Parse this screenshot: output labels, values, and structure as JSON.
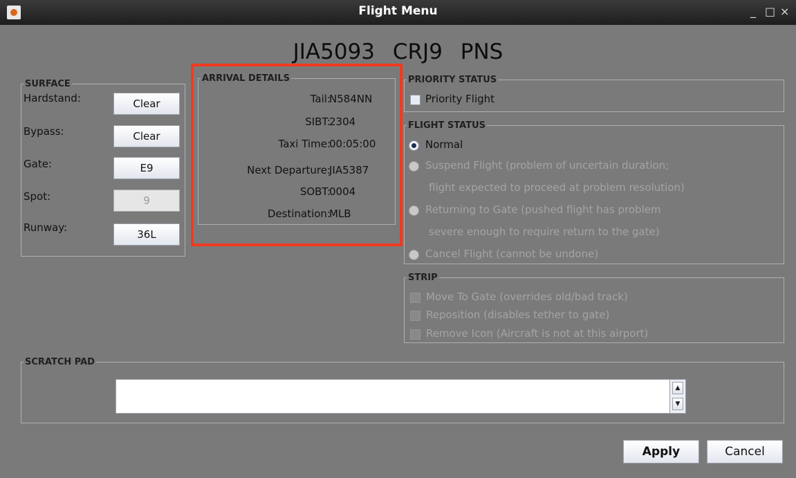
{
  "window": {
    "title": "Flight Menu",
    "minimize": "_",
    "maximize": "□",
    "close": "×",
    "app_icon": "java-cup-icon"
  },
  "header": {
    "callsign": "JIA5093",
    "aircraft_type": "CRJ9",
    "origin": "PNS"
  },
  "surface": {
    "legend": "SURFACE",
    "rows": [
      {
        "label": "Hardstand:",
        "button": "Clear"
      },
      {
        "label": "Bypass:",
        "button": "Clear"
      },
      {
        "label": "Gate:",
        "button": "E9"
      },
      {
        "label": "Spot:",
        "button": "9"
      },
      {
        "label": "Runway:",
        "button": "36L"
      }
    ]
  },
  "arrival": {
    "legend": "ARRIVAL DETAILS",
    "rows": [
      {
        "key": "Tail:",
        "value": "N584NN"
      },
      {
        "key": "SIBT:",
        "value": "2304"
      },
      {
        "key": "Taxi Time:",
        "value": "00:05:00"
      },
      {
        "key": "Next Departure:",
        "value": "JIA5387"
      },
      {
        "key": "SOBT:",
        "value": "0004"
      },
      {
        "key": "Destination:",
        "value": "MLB"
      }
    ]
  },
  "priority": {
    "legend": "PRIORITY STATUS",
    "checkbox_label": "Priority Flight",
    "checked": false
  },
  "flight_status": {
    "legend": "FLIGHT STATUS",
    "options": [
      {
        "line1": "Normal",
        "line2": "",
        "selected": true,
        "enabled": true
      },
      {
        "line1": "Suspend Flight (problem of uncertain duration;",
        "line2": "flight expected to proceed at problem resolution)",
        "selected": false,
        "enabled": false
      },
      {
        "line1": "Returning to Gate (pushed flight has problem",
        "line2": "severe enough to require return to the gate)",
        "selected": false,
        "enabled": false
      },
      {
        "line1": "Cancel Flight (cannot be undone)",
        "line2": "",
        "selected": false,
        "enabled": false
      }
    ]
  },
  "strip": {
    "legend": "STRIP",
    "items": [
      "Move To Gate (overrides old/bad track)",
      "Reposition (disables tether to gate)",
      "Remove Icon (Aircraft is not at this airport)"
    ]
  },
  "scratch_pad": {
    "legend": "SCRATCH PAD",
    "value": ""
  },
  "buttons": {
    "apply": "Apply",
    "cancel": "Cancel"
  },
  "colors": {
    "background": "#7b7a7b",
    "highlight": "#f23a1f",
    "titlebar": "#2a2a2a"
  }
}
